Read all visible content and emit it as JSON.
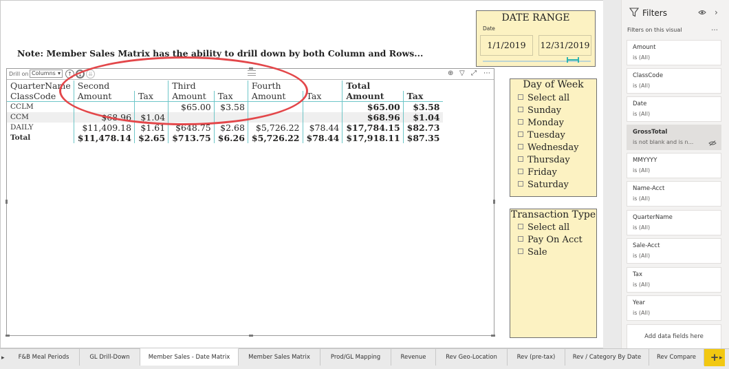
{
  "note": "Note: Member Sales Matrix has the ability to drill down by both Column and Rows...",
  "visual_header": {
    "drill_on_label": "Drill on",
    "drill_on_value": "Columns"
  },
  "matrix": {
    "col_groups": [
      "Second",
      "Third",
      "Fourth",
      "Total"
    ],
    "row_header_1": "QuarterName",
    "row_header_2": "ClassCode",
    "amount_label": "Amount",
    "tax_label": "Tax",
    "rows": [
      {
        "label": "CCLM",
        "cells": [
          "",
          "",
          "$65.00",
          "$3.58",
          "",
          "",
          "$65.00",
          "$3.58"
        ]
      },
      {
        "label": "CCM",
        "cells": [
          "$68.96",
          "$1.04",
          "",
          "",
          "",
          "",
          "$68.96",
          "$1.04"
        ]
      },
      {
        "label": "DAILY",
        "cells": [
          "$11,409.18",
          "$1.61",
          "$648.75",
          "$2.68",
          "$5,726.22",
          "$78.44",
          "$17,784.15",
          "$82.73"
        ]
      }
    ],
    "total": {
      "label": "Total",
      "cells": [
        "$11,478.14",
        "$2.65",
        "$713.75",
        "$6.26",
        "$5,726.22",
        "$78.44",
        "$17,918.11",
        "$87.35"
      ]
    }
  },
  "date_range": {
    "title": "DATE RANGE",
    "subtitle": "Date",
    "start": "1/1/2019",
    "end": "12/31/2019"
  },
  "day_of_week": {
    "title": "Day of Week",
    "items": [
      "Select all",
      "Sunday",
      "Monday",
      "Tuesday",
      "Wednesday",
      "Thursday",
      "Friday",
      "Saturday"
    ]
  },
  "transaction_type": {
    "title": "Transaction Type",
    "items": [
      "Select all",
      "Pay On Acct",
      "Sale"
    ]
  },
  "filters": {
    "title": "Filters",
    "subtitle": "Filters on this visual",
    "cards": [
      {
        "name": "Amount",
        "value": "is (All)"
      },
      {
        "name": "ClassCode",
        "value": "is (All)"
      },
      {
        "name": "Date",
        "value": "is (All)"
      },
      {
        "name": "GrossTotal",
        "value": "is not blank and is n..."
      },
      {
        "name": "MMYYYY",
        "value": "is (All)"
      },
      {
        "name": "Name-Acct",
        "value": "is (All)"
      },
      {
        "name": "QuarterName",
        "value": "is (All)"
      },
      {
        "name": "Sale-Acct",
        "value": "is (All)"
      },
      {
        "name": "Tax",
        "value": "is (All)"
      },
      {
        "name": "Year",
        "value": "is (All)"
      }
    ],
    "add_fields": "Add data fields here"
  },
  "tabs": [
    "F&B Meal Periods",
    "GL Drill-Down",
    "Member Sales - Date Matrix",
    "Member Sales Matrix",
    "Prod/GL Mapping",
    "Revenue",
    "Rev Geo-Location",
    "Rev (pre-tax)",
    "Rev / Category By Date",
    "Rev Compare"
  ],
  "active_tab": "Member Sales - Date Matrix",
  "colors": {
    "accent_teal": "#2db3b0",
    "slicer_bg": "#fcf2c2",
    "highlight_oval": "#e3474a",
    "add_page": "#f2c811"
  }
}
